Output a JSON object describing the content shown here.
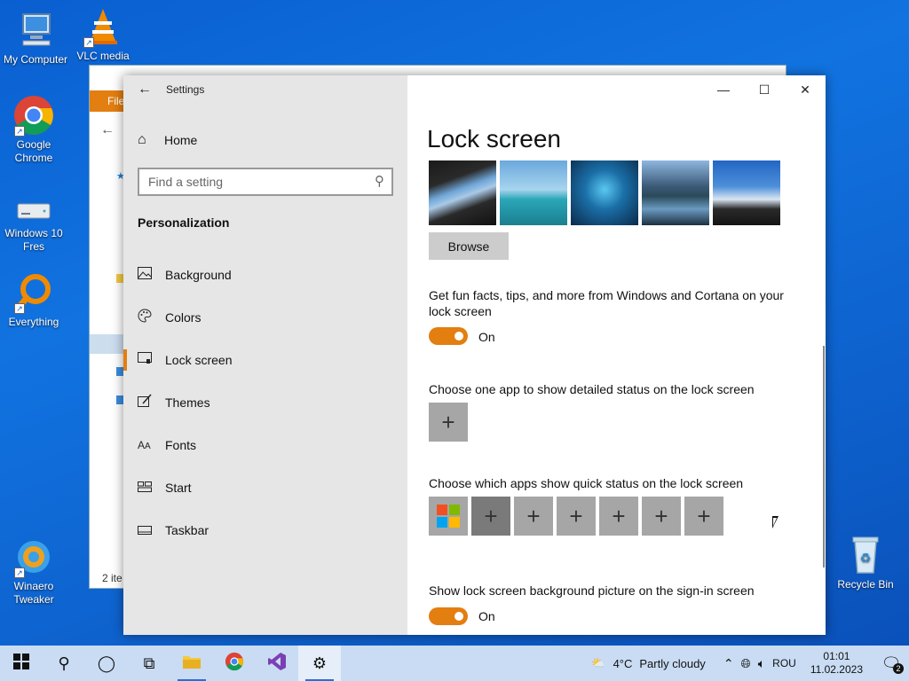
{
  "desktop": {
    "icons": [
      {
        "label": "My Computer"
      },
      {
        "label": "VLC media"
      },
      {
        "label": "Google Chrome"
      },
      {
        "label": "Windows 10 Fres"
      },
      {
        "label": "Everything"
      },
      {
        "label": "Winaero Tweaker"
      },
      {
        "label": "Recycle Bin"
      }
    ]
  },
  "explorer": {
    "ribbon_tab": "File",
    "status": "2 ite"
  },
  "settings": {
    "window_title": "Settings",
    "home_label": "Home",
    "search_placeholder": "Find a setting",
    "section_title": "Personalization",
    "nav_items": [
      {
        "label": "Background",
        "icon": "picture-icon"
      },
      {
        "label": "Colors",
        "icon": "palette-icon"
      },
      {
        "label": "Lock screen",
        "icon": "lock-screen-icon"
      },
      {
        "label": "Themes",
        "icon": "themes-icon"
      },
      {
        "label": "Fonts",
        "icon": "fonts-icon"
      },
      {
        "label": "Start",
        "icon": "start-icon"
      },
      {
        "label": "Taskbar",
        "icon": "taskbar-icon"
      }
    ],
    "page_title": "Lock screen",
    "browse_label": "Browse",
    "fun_facts_label": "Get fun facts, tips, and more from Windows and Cortana on your lock screen",
    "fun_facts_state": "On",
    "detailed_status_label": "Choose one app to show detailed status on the lock screen",
    "quick_status_label": "Choose which apps show quick status on the lock screen",
    "signin_bg_label": "Show lock screen background picture on the sign-in screen",
    "signin_bg_state": "On",
    "accent_color": "#e37e10"
  },
  "taskbar": {
    "weather_temp": "4°C",
    "weather_text": "Partly cloudy",
    "language": "ROU",
    "time": "01:01",
    "date": "11.02.2023",
    "notification_count": "2"
  }
}
